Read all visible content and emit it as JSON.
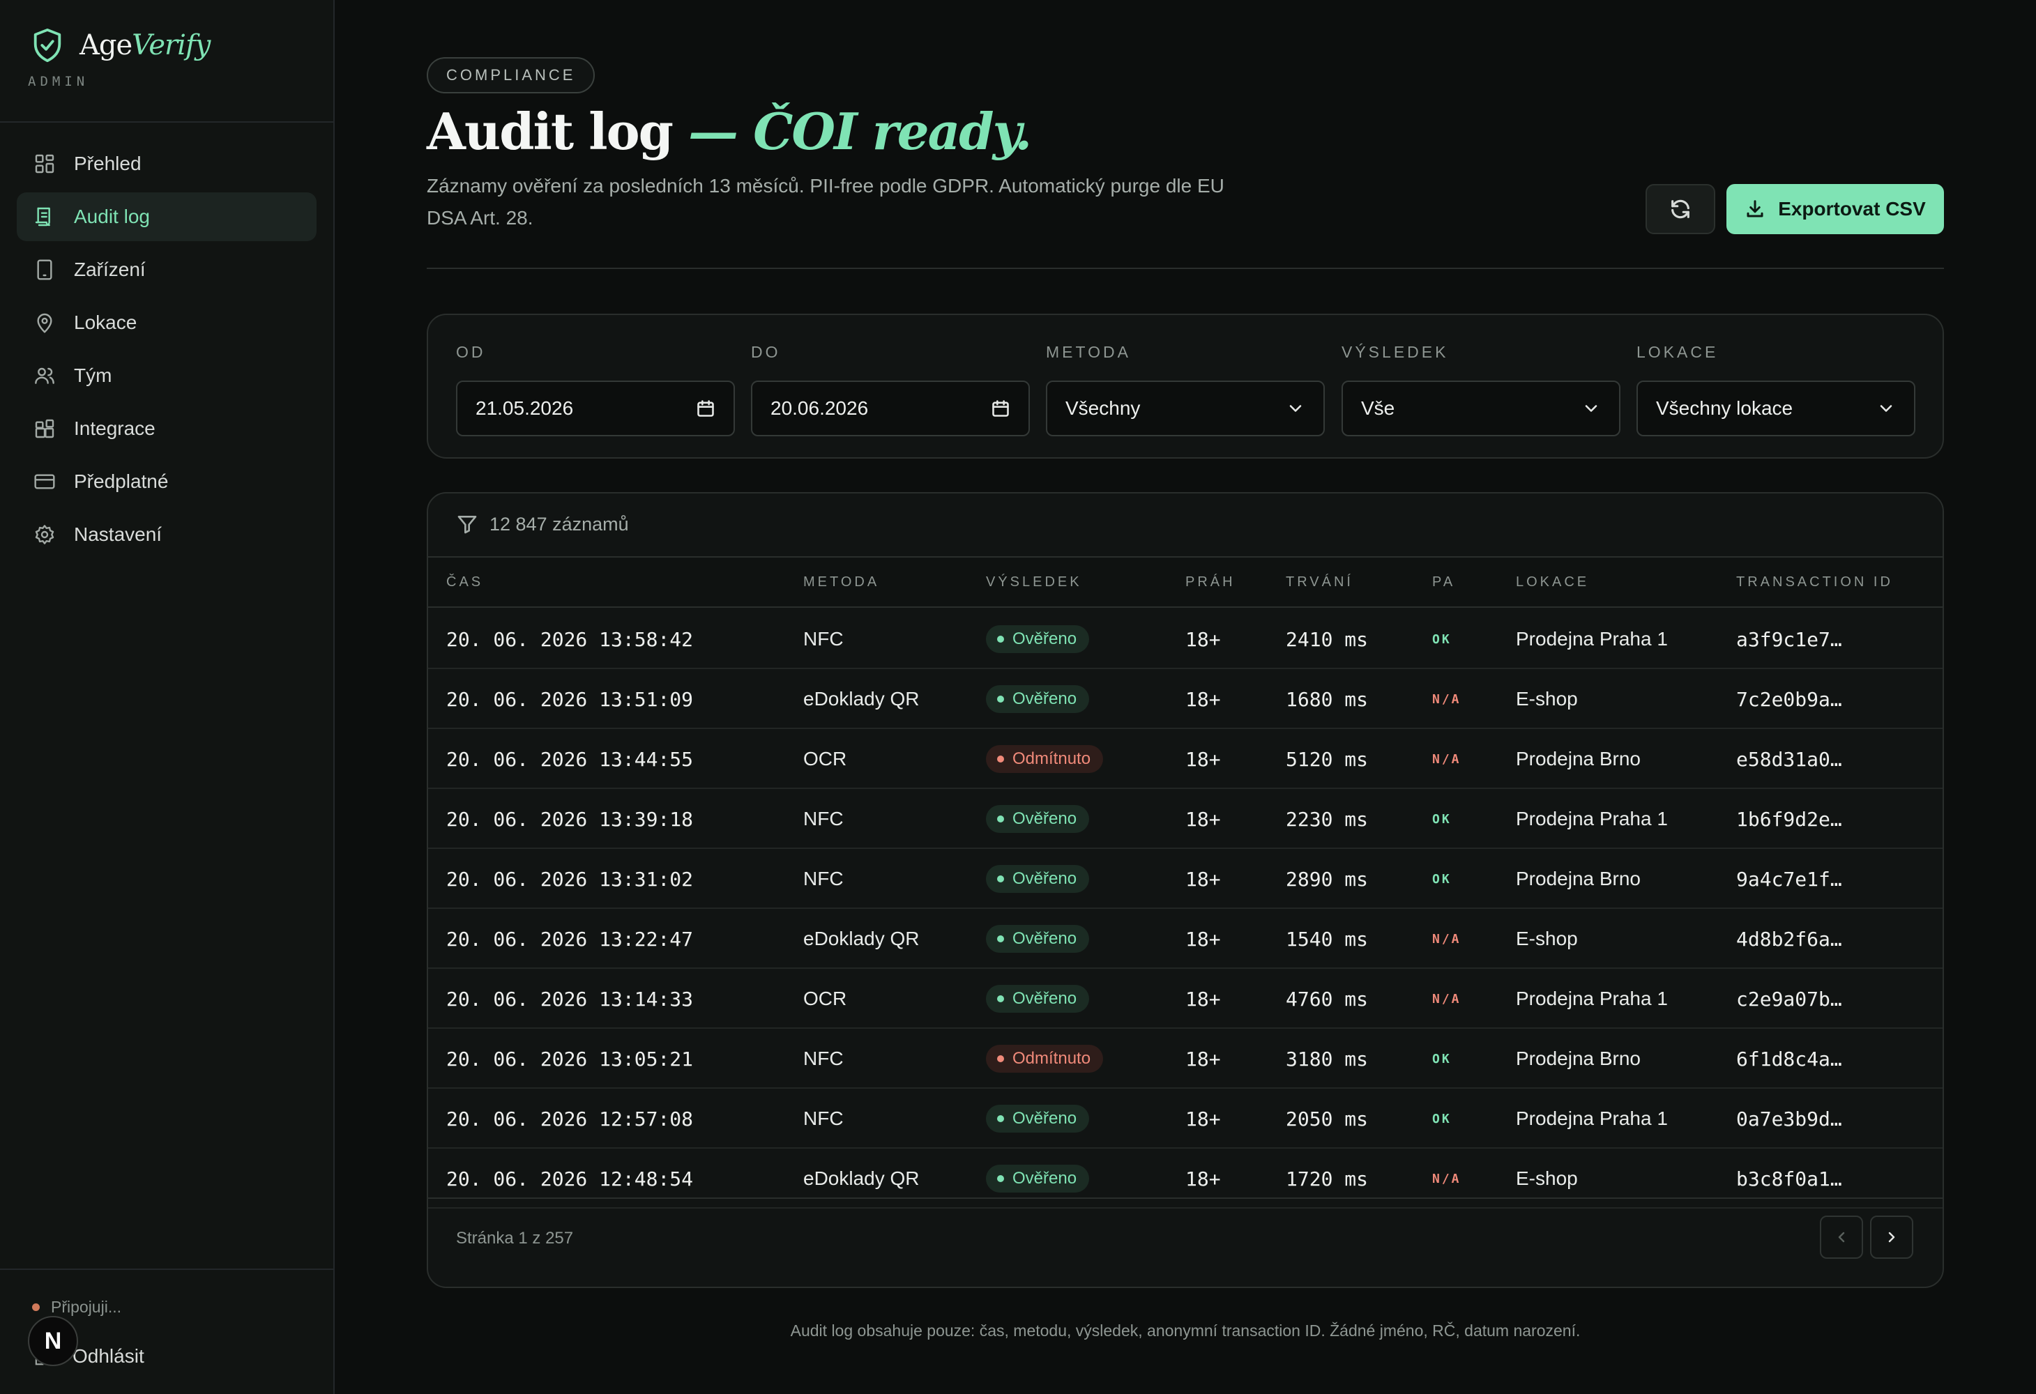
{
  "brand": {
    "name_a": "Age",
    "name_b": "Verify",
    "sub": "ADMIN",
    "logo_icon": "shield-check-icon"
  },
  "nav": [
    {
      "label": "Přehled",
      "icon": "dashboard-icon",
      "active": false
    },
    {
      "label": "Audit log",
      "icon": "receipt-icon",
      "active": true
    },
    {
      "label": "Zařízení",
      "icon": "tablet-icon",
      "active": false
    },
    {
      "label": "Lokace",
      "icon": "map-pin-icon",
      "active": false
    },
    {
      "label": "Tým",
      "icon": "users-icon",
      "active": false
    },
    {
      "label": "Integrace",
      "icon": "blocks-icon",
      "active": false
    },
    {
      "label": "Předplatné",
      "icon": "credit-card-icon",
      "active": false
    },
    {
      "label": "Nastavení",
      "icon": "gear-icon",
      "active": false
    }
  ],
  "sidebar_footer": {
    "status": "Připojuji...",
    "logout": "Odhlásit",
    "avatar_letter": "N"
  },
  "header": {
    "pill": "COMPLIANCE",
    "title_main": "Audit log",
    "title_accent": "— ČOI ready.",
    "subtitle": "Záznamy ověření za posledních 13 měsíců. PII-free podle GDPR. Automatický purge dle EU DSA Art. 28.",
    "export_label": "Exportovat CSV"
  },
  "filters": {
    "from": {
      "label": "OD",
      "value": "21.05.2026"
    },
    "to": {
      "label": "DO",
      "value": "20.06.2026"
    },
    "method": {
      "label": "METODA",
      "value": "Všechny"
    },
    "result": {
      "label": "VÝSLEDEK",
      "value": "Vše"
    },
    "location": {
      "label": "LOKACE",
      "value": "Všechny lokace"
    }
  },
  "table": {
    "count": "12 847 záznamů",
    "columns": [
      "ČAS",
      "METODA",
      "VÝSLEDEK",
      "PRÁH",
      "TRVÁNÍ",
      "PA",
      "LOKACE",
      "TRANSACTION ID"
    ],
    "rows": [
      {
        "time": "20. 06. 2026 13:58:42",
        "method": "NFC",
        "result": "Ověřeno",
        "ok": true,
        "threshold": "18+",
        "duration": "2410 ms",
        "pa": "OK",
        "location": "Prodejna Praha 1",
        "tx": "a3f9c1e7…"
      },
      {
        "time": "20. 06. 2026 13:51:09",
        "method": "eDoklady QR",
        "result": "Ověřeno",
        "ok": true,
        "threshold": "18+",
        "duration": "1680 ms",
        "pa": "N/A",
        "location": "E-shop",
        "tx": "7c2e0b9a…"
      },
      {
        "time": "20. 06. 2026 13:44:55",
        "method": "OCR",
        "result": "Odmítnuto",
        "ok": false,
        "threshold": "18+",
        "duration": "5120 ms",
        "pa": "N/A",
        "location": "Prodejna Brno",
        "tx": "e58d31a0…"
      },
      {
        "time": "20. 06. 2026 13:39:18",
        "method": "NFC",
        "result": "Ověřeno",
        "ok": true,
        "threshold": "18+",
        "duration": "2230 ms",
        "pa": "OK",
        "location": "Prodejna Praha 1",
        "tx": "1b6f9d2e…"
      },
      {
        "time": "20. 06. 2026 13:31:02",
        "method": "NFC",
        "result": "Ověřeno",
        "ok": true,
        "threshold": "18+",
        "duration": "2890 ms",
        "pa": "OK",
        "location": "Prodejna Brno",
        "tx": "9a4c7e1f…"
      },
      {
        "time": "20. 06. 2026 13:22:47",
        "method": "eDoklady QR",
        "result": "Ověřeno",
        "ok": true,
        "threshold": "18+",
        "duration": "1540 ms",
        "pa": "N/A",
        "location": "E-shop",
        "tx": "4d8b2f6a…"
      },
      {
        "time": "20. 06. 2026 13:14:33",
        "method": "OCR",
        "result": "Ověřeno",
        "ok": true,
        "threshold": "18+",
        "duration": "4760 ms",
        "pa": "N/A",
        "location": "Prodejna Praha 1",
        "tx": "c2e9a07b…"
      },
      {
        "time": "20. 06. 2026 13:05:21",
        "method": "NFC",
        "result": "Odmítnuto",
        "ok": false,
        "threshold": "18+",
        "duration": "3180 ms",
        "pa": "OK",
        "location": "Prodejna Brno",
        "tx": "6f1d8c4a…"
      },
      {
        "time": "20. 06. 2026 12:57:08",
        "method": "NFC",
        "result": "Ověřeno",
        "ok": true,
        "threshold": "18+",
        "duration": "2050 ms",
        "pa": "OK",
        "location": "Prodejna Praha 1",
        "tx": "0a7e3b9d…"
      },
      {
        "time": "20. 06. 2026 12:48:54",
        "method": "eDoklady QR",
        "result": "Ověřeno",
        "ok": true,
        "threshold": "18+",
        "duration": "1720 ms",
        "pa": "N/A",
        "location": "E-shop",
        "tx": "b3c8f0a1…"
      }
    ],
    "page_info": "Stránka 1 z 257"
  },
  "footer_note": "Audit log obsahuje pouze: čas, metodu, výsledek, anonymní transaction ID. Žádné jméno, RČ, datum narození.",
  "colors": {
    "accent": "#7fe3b4",
    "danger": "#f08a7a",
    "background": "#0c0e0d"
  }
}
